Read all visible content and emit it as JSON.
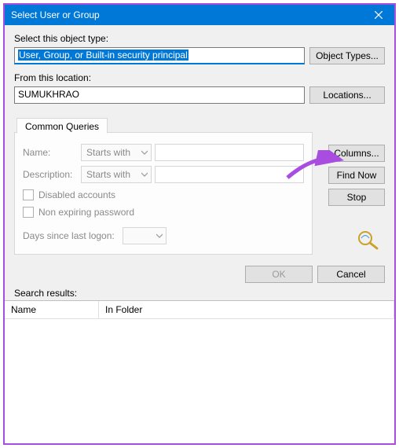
{
  "titlebar": {
    "title": "Select User or Group"
  },
  "section1": {
    "label": "Select this object type:",
    "value": "User, Group, or Built-in security principal",
    "button": "Object Types..."
  },
  "section2": {
    "label": "From this location:",
    "value": "SUMUKHRAO",
    "button": "Locations..."
  },
  "tab": {
    "label": "Common Queries"
  },
  "form": {
    "name_label": "Name:",
    "name_mode": "Starts with",
    "desc_label": "Description:",
    "desc_mode": "Starts with",
    "chk_disabled": "Disabled accounts",
    "chk_nonexp": "Non expiring password",
    "logon_label": "Days since last logon:"
  },
  "sidebar": {
    "columns": "Columns...",
    "findnow": "Find Now",
    "stop": "Stop"
  },
  "bottom": {
    "ok": "OK",
    "cancel": "Cancel",
    "search": "Search results:"
  },
  "results": {
    "col_name": "Name",
    "col_folder": "In Folder"
  }
}
